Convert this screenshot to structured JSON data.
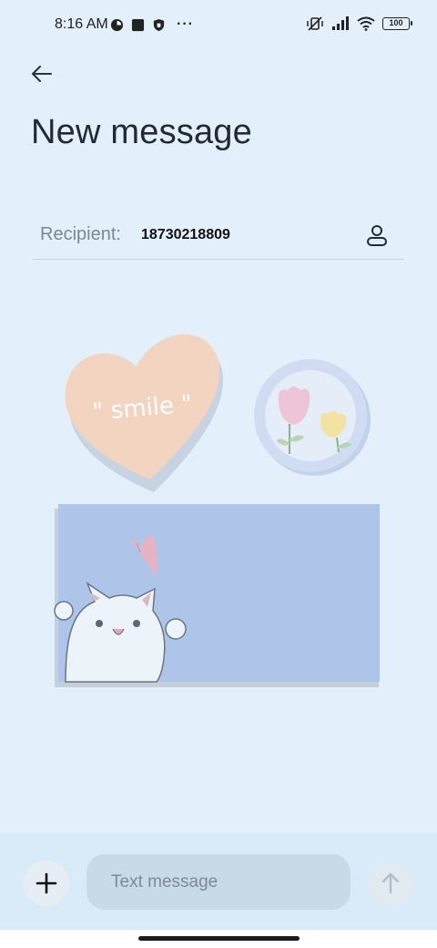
{
  "status_bar": {
    "time": "8:16 AM",
    "battery": "100",
    "icons": [
      "circle-badge-icon",
      "square-icon",
      "shield-icon",
      "more-dots-icon",
      "mute-vibrate-icon",
      "signal-icon",
      "wifi-icon",
      "battery-icon"
    ],
    "more_label": "···"
  },
  "header": {
    "back_icon": "back-arrow-icon",
    "title": "New message"
  },
  "recipient": {
    "label": "Recipient:",
    "value": "18730218809",
    "contact_icon": "contact-person-icon"
  },
  "stickers": {
    "heart_text": "\" smile \""
  },
  "composer": {
    "add_icon": "plus-icon",
    "placeholder": "Text message",
    "value": "",
    "send_icon": "send-arrow-up-icon"
  },
  "colors": {
    "background": "#e3f0fb",
    "bottom_bar": "#d9eaf9",
    "input_bg": "#c8d9e8",
    "heart": "#f3d4c0",
    "card": "#aec4e8"
  }
}
